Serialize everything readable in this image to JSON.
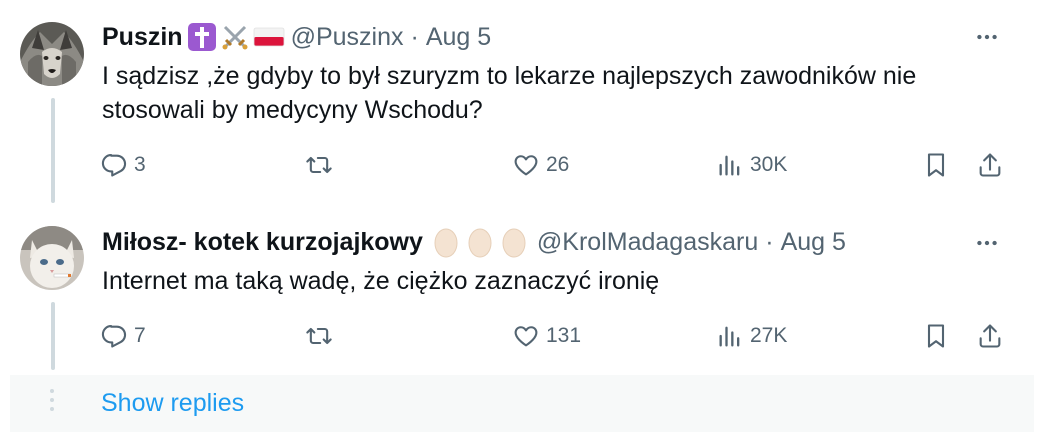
{
  "colors": {
    "text": "#0f1419",
    "secondary": "#536471",
    "link": "#1d9bf0",
    "thread_line": "#cfd9de",
    "show_replies_bg": "#f7f9f9"
  },
  "tweets": [
    {
      "display_name": "Puszin",
      "badges": [
        "latin-cross-emoji",
        "crossed-swords-emoji",
        "poland-flag-emoji"
      ],
      "handle": "@Puszinx",
      "separator": "·",
      "date": "Aug 5",
      "avatar": "wolf-avatar",
      "text_lines": [
        "I sądzisz ,że gdyby to był szuryzm to lekarze najlepszych zawodników nie",
        "stosowali by medycyny Wschodu?"
      ],
      "replies": "3",
      "retweets": "",
      "likes": "26",
      "views": "30K"
    },
    {
      "display_name": "Miłosz- kotek kurzojajkowy",
      "badges": [
        "egg-emoji",
        "egg-emoji",
        "egg-emoji"
      ],
      "handle": "@KrolMadagaskaru",
      "separator": "·",
      "date": "Aug 5",
      "avatar": "cat-avatar",
      "text_lines": [
        "Internet ma taką wadę, że ciężko zaznaczyć ironię"
      ],
      "replies": "7",
      "retweets": "",
      "likes": "131",
      "views": "27K"
    }
  ],
  "show_replies": "Show replies",
  "icons": [
    "more-icon",
    "reply-icon",
    "retweet-icon",
    "like-icon",
    "views-icon",
    "bookmark-icon",
    "share-icon"
  ]
}
